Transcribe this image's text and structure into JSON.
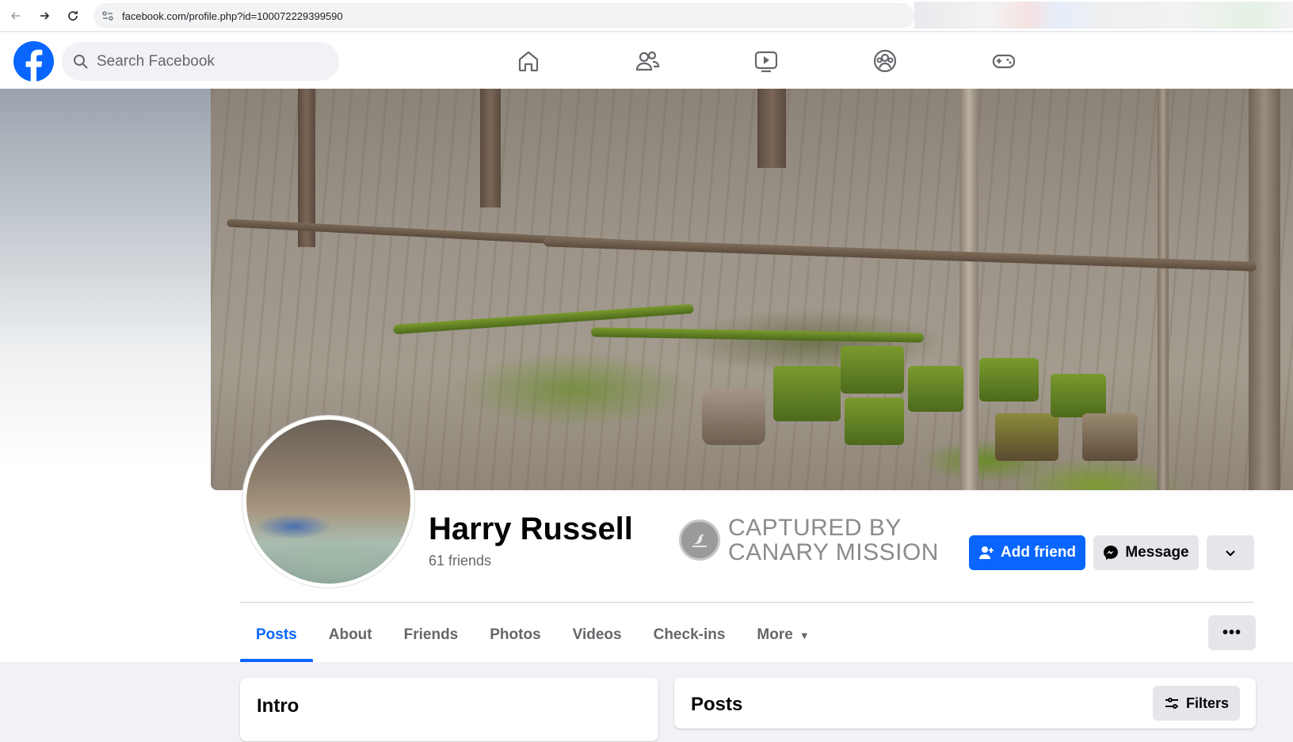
{
  "browser": {
    "url": "facebook.com/profile.php?id=100072229399590"
  },
  "header": {
    "search_placeholder": "Search Facebook",
    "nav_icons": [
      "home-icon",
      "friends-icon",
      "video-icon",
      "groups-icon",
      "gaming-icon"
    ]
  },
  "profile": {
    "name": "Harry Russell",
    "friends_count": "61 friends",
    "watermark_line1": "CAPTURED BY",
    "watermark_line2": "CANARY MISSION",
    "add_friend_label": "Add friend",
    "message_label": "Message"
  },
  "tabs": [
    {
      "label": "Posts",
      "active": true
    },
    {
      "label": "About"
    },
    {
      "label": "Friends"
    },
    {
      "label": "Photos"
    },
    {
      "label": "Videos"
    },
    {
      "label": "Check-ins"
    },
    {
      "label": "More"
    }
  ],
  "cards": {
    "intro_title": "Intro",
    "posts_title": "Posts",
    "filters_label": "Filters"
  },
  "colors": {
    "brand_blue": "#0866ff",
    "secondary_grey": "#e4e6eb",
    "text_muted": "#65676b"
  }
}
